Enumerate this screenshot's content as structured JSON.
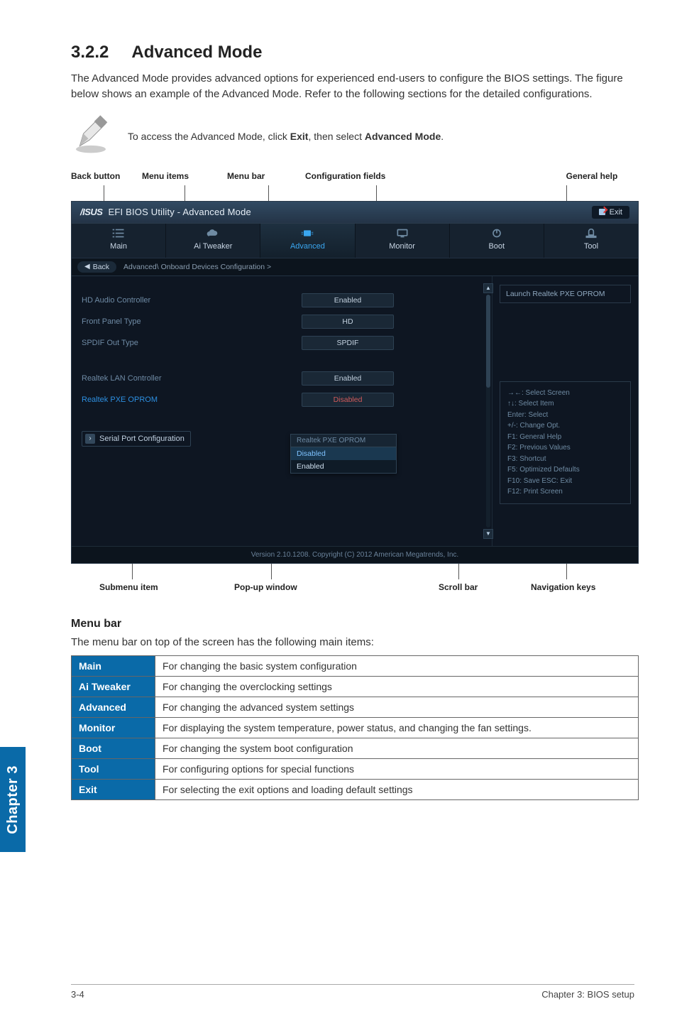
{
  "sectionNumber": "3.2.2",
  "sectionTitle": "Advanced Mode",
  "intro": "The Advanced Mode provides advanced options for experienced end-users to configure the BIOS settings. The figure below shows an example of the Advanced Mode. Refer to the following sections for the detailed configurations.",
  "note": {
    "prefix": "To access the Advanced Mode, click ",
    "b1": "Exit",
    "mid": ", then select ",
    "b2": "Advanced Mode",
    "suffix": "."
  },
  "topLabels": {
    "backButton": "Back button",
    "menuItems": "Menu items",
    "menuBar": "Menu bar",
    "configFields": "Configuration fields",
    "generalHelp": "General help"
  },
  "bottomLabels": {
    "submenuItem": "Submenu item",
    "popup": "Pop-up window",
    "scrollBar": "Scroll bar",
    "navKeys": "Navigation keys"
  },
  "bios": {
    "title": "EFI BIOS Utility - Advanced Mode",
    "exit": "Exit",
    "tabs": {
      "main": "Main",
      "ai": "Ai Tweaker",
      "advanced": "Advanced",
      "monitor": "Monitor",
      "boot": "Boot",
      "tool": "Tool"
    },
    "back": "Back",
    "breadcrumb": "Advanced\\ Onboard Devices Configuration  >",
    "rows": {
      "hdAudio": {
        "label": "HD Audio Controller",
        "value": "Enabled"
      },
      "frontPanel": {
        "label": "Front Panel Type",
        "value": "HD"
      },
      "spdif": {
        "label": "SPDIF Out Type",
        "value": "SPDIF"
      },
      "lan": {
        "label": "Realtek LAN Controller",
        "value": "Enabled"
      },
      "pxe": {
        "label": "Realtek PXE OPROM",
        "value": "Disabled"
      },
      "serial": {
        "label": "Serial Port Configuration"
      }
    },
    "popup": {
      "title": "Realtek PXE OPROM",
      "opt1": "Disabled",
      "opt2": "Enabled"
    },
    "help": "Launch Realtek PXE OPROM",
    "navKeys": {
      "l1": "→←: Select Screen",
      "l2": "↑↓: Select Item",
      "l3": "Enter: Select",
      "l4": "+/-: Change Opt.",
      "l5": "F1: General Help",
      "l6": "F2: Previous Values",
      "l7": "F3: Shortcut",
      "l8": "F5: Optimized Defaults",
      "l9": "F10: Save   ESC: Exit",
      "l10": "F12: Print Screen"
    },
    "footer": "Version 2.10.1208.  Copyright (C) 2012 American Megatrends, Inc."
  },
  "menuBarHeading": "Menu bar",
  "menuBarDesc": "The menu bar on top of the screen has the following main items:",
  "menuTable": {
    "main": {
      "k": "Main",
      "v": "For changing the basic system configuration"
    },
    "ai": {
      "k": "Ai Tweaker",
      "v": "For changing the overclocking settings"
    },
    "advanced": {
      "k": "Advanced",
      "v": "For changing the advanced system settings"
    },
    "monitor": {
      "k": "Monitor",
      "v": "For displaying the system temperature, power status, and changing the fan settings."
    },
    "boot": {
      "k": "Boot",
      "v": "For changing the system boot configuration"
    },
    "tool": {
      "k": "Tool",
      "v": "For configuring options for special functions"
    },
    "exit": {
      "k": "Exit",
      "v": "For selecting the exit options and loading default settings"
    }
  },
  "sideTab": "Chapter 3",
  "footer": {
    "pageNum": "3-4",
    "chapter": "Chapter 3: BIOS setup"
  }
}
